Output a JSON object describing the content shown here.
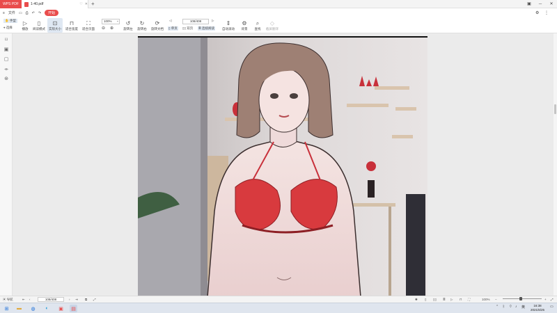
{
  "titlebar": {
    "app_label": "WPS PDF",
    "doc_tab": "1-40.pdf",
    "new_tab": "+",
    "min": "─",
    "max": "☐",
    "close": "✕"
  },
  "menubar": {
    "menu": "≡",
    "file": "文件",
    "start": "开始"
  },
  "toolbar": {
    "hand": "手型",
    "select": "选择",
    "play": "播放",
    "read_mode": "阅读模式",
    "actual_size": "实际大小",
    "fit_width": "适合宽度",
    "fit_page": "适合页面",
    "zoom_value": "100%",
    "rotate_left": "旋转左",
    "rotate_right": "旋转右",
    "rotate_doc": "旋转文档",
    "single_page": "单页",
    "double_page": "双页",
    "continuous_read": "连续阅读",
    "page_value": "108/408",
    "auto_scroll": "自动滚动",
    "background": "背景",
    "screenshot": "查找",
    "compare": "截屏翻译"
  },
  "statusbar": {
    "outline": "导航",
    "page_value": "108/408",
    "zoom": "100%"
  },
  "taskbar": {
    "time": "16:38",
    "date": "2021/6/25"
  },
  "colors": {
    "brand": "#e94c4c",
    "active_tool": "#dfe8f3"
  }
}
